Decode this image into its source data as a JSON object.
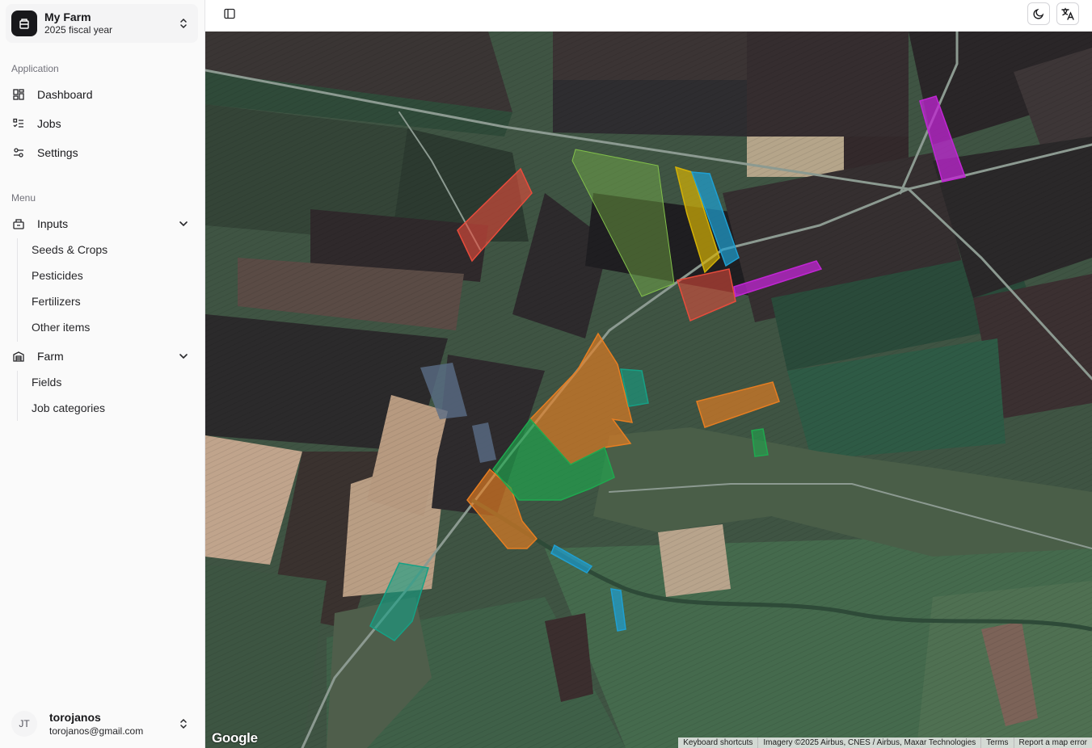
{
  "farm": {
    "name": "My Farm",
    "subtitle": "2025 fiscal year"
  },
  "sidebar": {
    "application_label": "Application",
    "application_items": [
      {
        "label": "Dashboard",
        "icon": "dashboard-icon"
      },
      {
        "label": "Jobs",
        "icon": "list-checks-icon"
      },
      {
        "label": "Settings",
        "icon": "sliders-icon"
      }
    ],
    "menu_label": "Menu",
    "inputs": {
      "label": "Inputs",
      "icon": "package-icon",
      "items": [
        "Seeds & Crops",
        "Pesticides",
        "Fertilizers",
        "Other items"
      ]
    },
    "farm_group": {
      "label": "Farm",
      "icon": "warehouse-icon",
      "items": [
        "Fields",
        "Job categories"
      ]
    }
  },
  "user": {
    "initials": "JT",
    "name": "torojanos",
    "email": "torojanos@gmail.com"
  },
  "header": {
    "toggle_icon": "sidebar-toggle-icon",
    "theme_icon": "moon-icon",
    "language_icon": "translate-icon"
  },
  "map": {
    "logo": "Google",
    "attribution": [
      "Keyboard shortcuts",
      "Imagery ©2025 Airbus, CNES / Airbus, Maxar Technologies",
      "Terms",
      "Report a map error"
    ],
    "field_colors": {
      "orange": "#e67e22",
      "green": "#1fa84f",
      "red": "#e74c3c",
      "yellow": "#d4b106",
      "blue": "#1f9fd1",
      "magenta": "#c026d3",
      "teal": "#16a085"
    }
  }
}
